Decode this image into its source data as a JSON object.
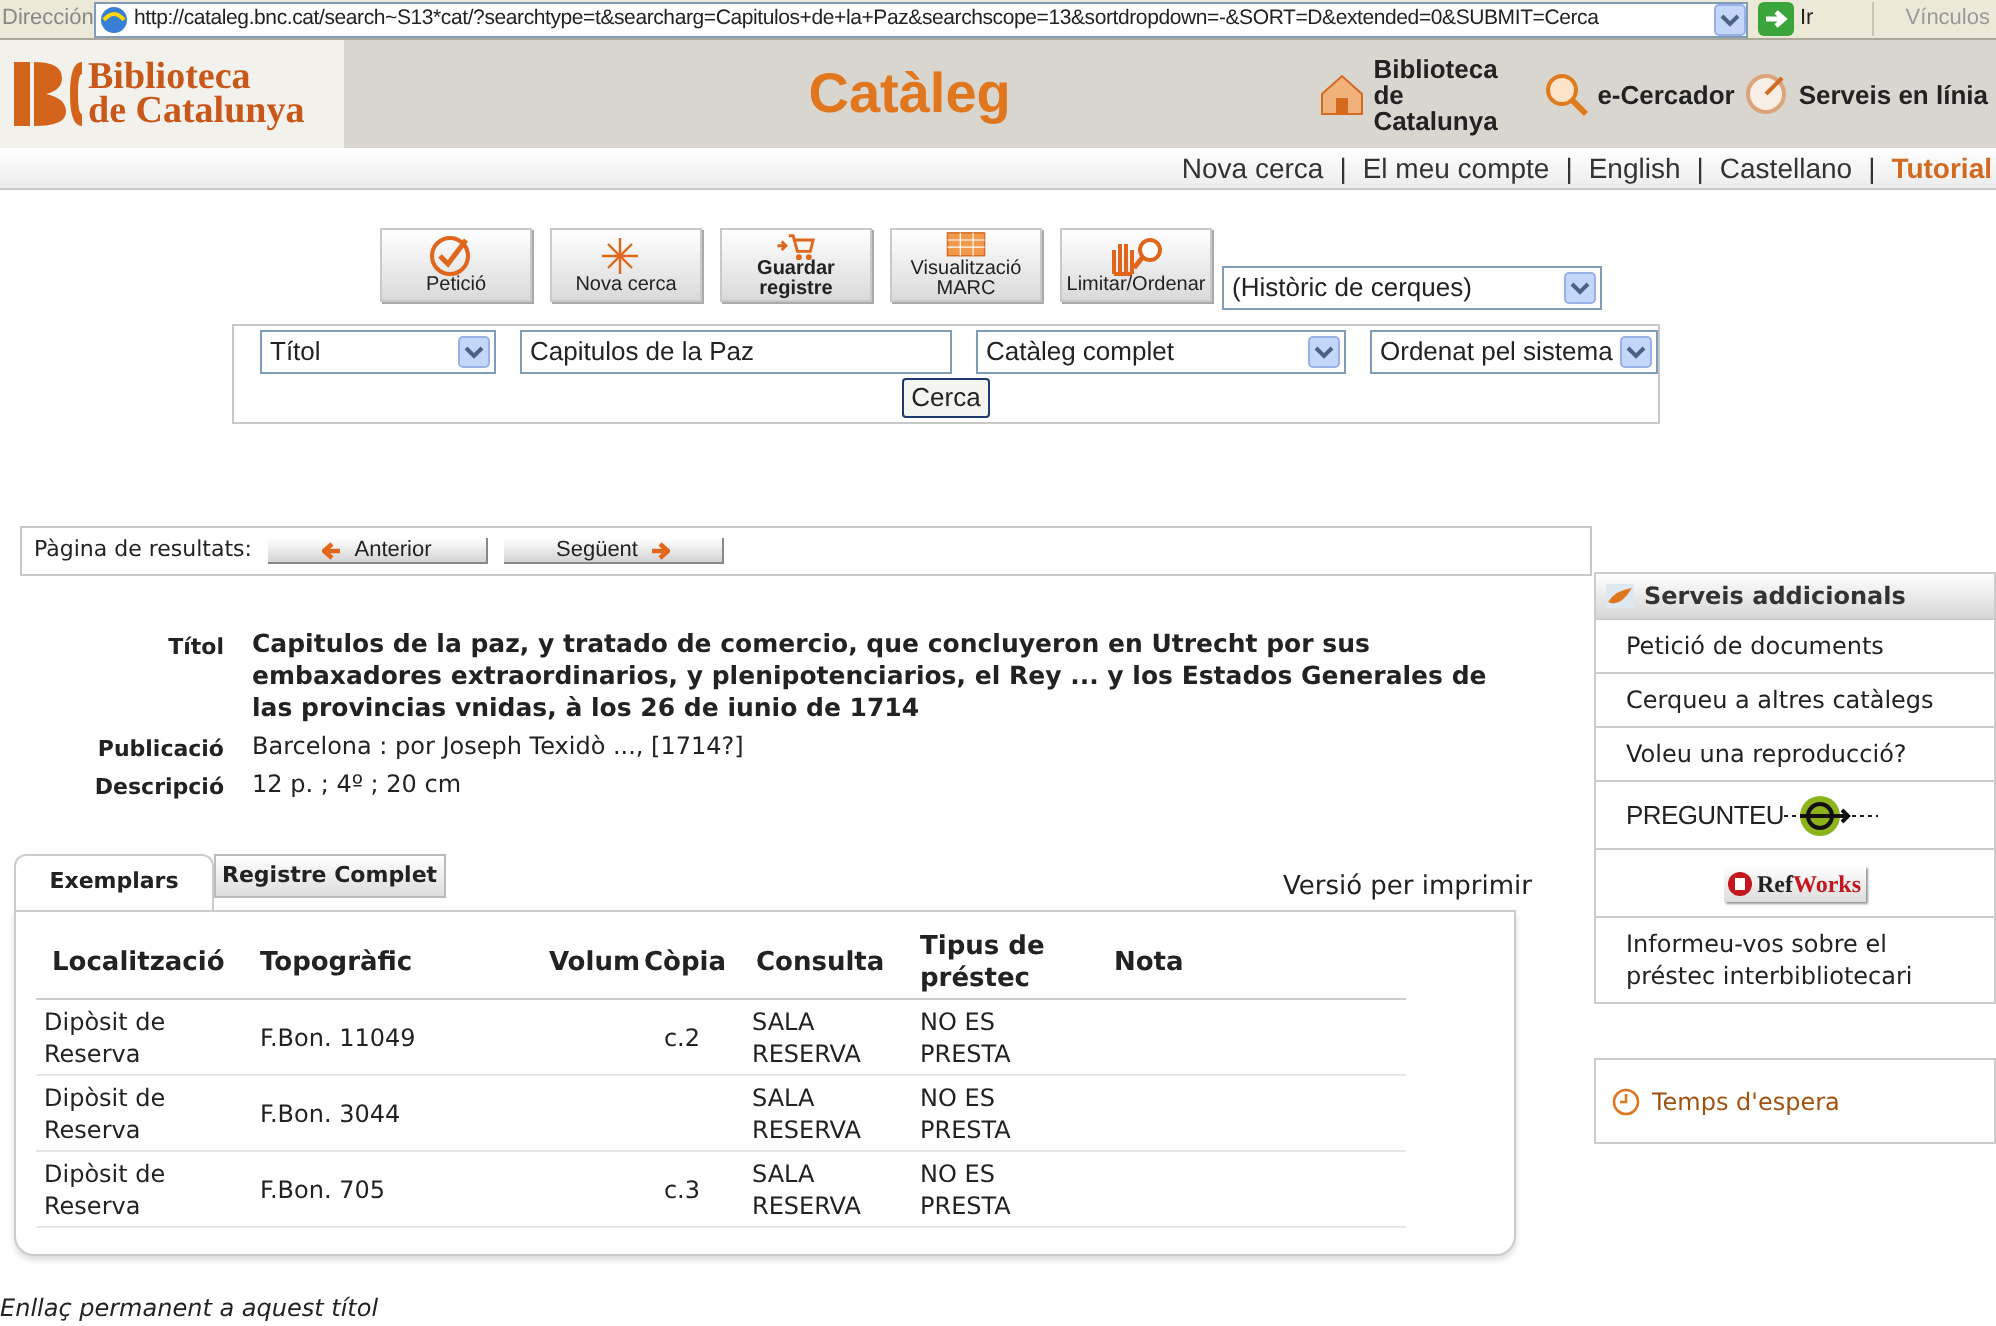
{
  "address_bar": {
    "label": "Dirección",
    "url": "http://cataleg.bnc.cat/search~S13*cat/?searchtype=t&searcharg=Capitulos+de+la+Paz&searchscope=13&sortdropdown=-&SORT=D&extended=0&SUBMIT=Cerca",
    "go": "Ir",
    "links": "Vínculos"
  },
  "header": {
    "logo_lines": [
      "Biblioteca",
      "de Catalunya"
    ],
    "title": "Catàleg",
    "links": [
      {
        "kind": "home",
        "label": "Biblioteca de Catalunya"
      },
      {
        "kind": "search",
        "label": "e-Cercador"
      },
      {
        "kind": "dish",
        "label": "Serveis en línia"
      }
    ]
  },
  "nav": {
    "separator": "|",
    "items": [
      {
        "label": "Nova cerca",
        "highlight": false
      },
      {
        "label": "El meu compte",
        "highlight": false
      },
      {
        "label": "English",
        "highlight": false
      },
      {
        "label": "Castellano",
        "highlight": false
      },
      {
        "label": "Tutorial",
        "highlight": true
      }
    ]
  },
  "toolbar": {
    "buttons": [
      {
        "kind": "request",
        "label": "Petició"
      },
      {
        "kind": "new",
        "label": "Nova cerca"
      },
      {
        "kind": "save",
        "label": "Guardar registre"
      },
      {
        "kind": "marc",
        "label": "Visualització MARC"
      },
      {
        "kind": "limit",
        "label": "Limitar/Ordenar"
      }
    ],
    "history_select": "(Històric de cerques)"
  },
  "search": {
    "field_select": "Títol",
    "query": "Capitulos de la Paz",
    "scope_select": "Catàleg complet",
    "sort_select": "Ordenat pel sistema",
    "submit": "Cerca"
  },
  "pagination": {
    "label": "Pàgina de resultats:",
    "previous": "Anterior",
    "next": "Següent"
  },
  "record": [
    {
      "label": "Títol",
      "value": "Capitulos de la paz, y tratado de comercio, que concluyeron en Utrecht por sus embaxadores extraordinarios, y plenipotenciarios, el Rey ... y los Estados Generales de las provincias vnidas, à los 26 de iunio de 1714",
      "bold": true
    },
    {
      "label": "Publicació",
      "value": "Barcelona : por Joseph Texidò ..., [1714?]",
      "bold": false
    },
    {
      "label": "Descripció",
      "value": "12 p. ; 4º ; 20 cm",
      "bold": false
    }
  ],
  "tabs": [
    {
      "label": "Exemplars",
      "selected": true
    },
    {
      "label": "Registre Complet",
      "selected": false
    }
  ],
  "print_link": "Versió per imprimir",
  "table": {
    "columns": [
      "Localització",
      "Topogràfic",
      "Volum",
      "Còpia",
      "Consulta",
      "Tipus de préstec",
      "Nota"
    ],
    "rows": [
      {
        "location": "Dipòsit de Reserva",
        "shelfmark": "F.Bon. 11049",
        "copy": "c.2",
        "consultation": "SALA RESERVA",
        "loan_type": "NO ES PRESTA"
      },
      {
        "location": "Dipòsit de Reserva",
        "shelfmark": "F.Bon. 3044",
        "consultation": "SALA RESERVA",
        "loan_type": "NO ES PRESTA"
      },
      {
        "location": "Dipòsit de Reserva",
        "shelfmark": "F.Bon. 705",
        "copy": "c.3",
        "consultation": "SALA RESERVA",
        "loan_type": "NO ES PRESTA"
      }
    ]
  },
  "sidebar": {
    "title": "Serveis addicionals",
    "items": [
      {
        "kind": "link",
        "label": "Petició de documents"
      },
      {
        "kind": "link",
        "label": "Cerqueu a altres catàlegs"
      },
      {
        "kind": "link",
        "label": "Voleu una reproducció?"
      },
      {
        "kind": "pregunteu",
        "label": "PREGUNTEU"
      },
      {
        "kind": "refworks",
        "parts": [
          "Ref",
          "Works"
        ]
      },
      {
        "kind": "link",
        "label": "Informeu-vos sobre el préstec interbibliotecari"
      }
    ]
  },
  "wait_link": "Temps d'espera",
  "footer_link": "Enllaç permanent a aquest títol"
}
